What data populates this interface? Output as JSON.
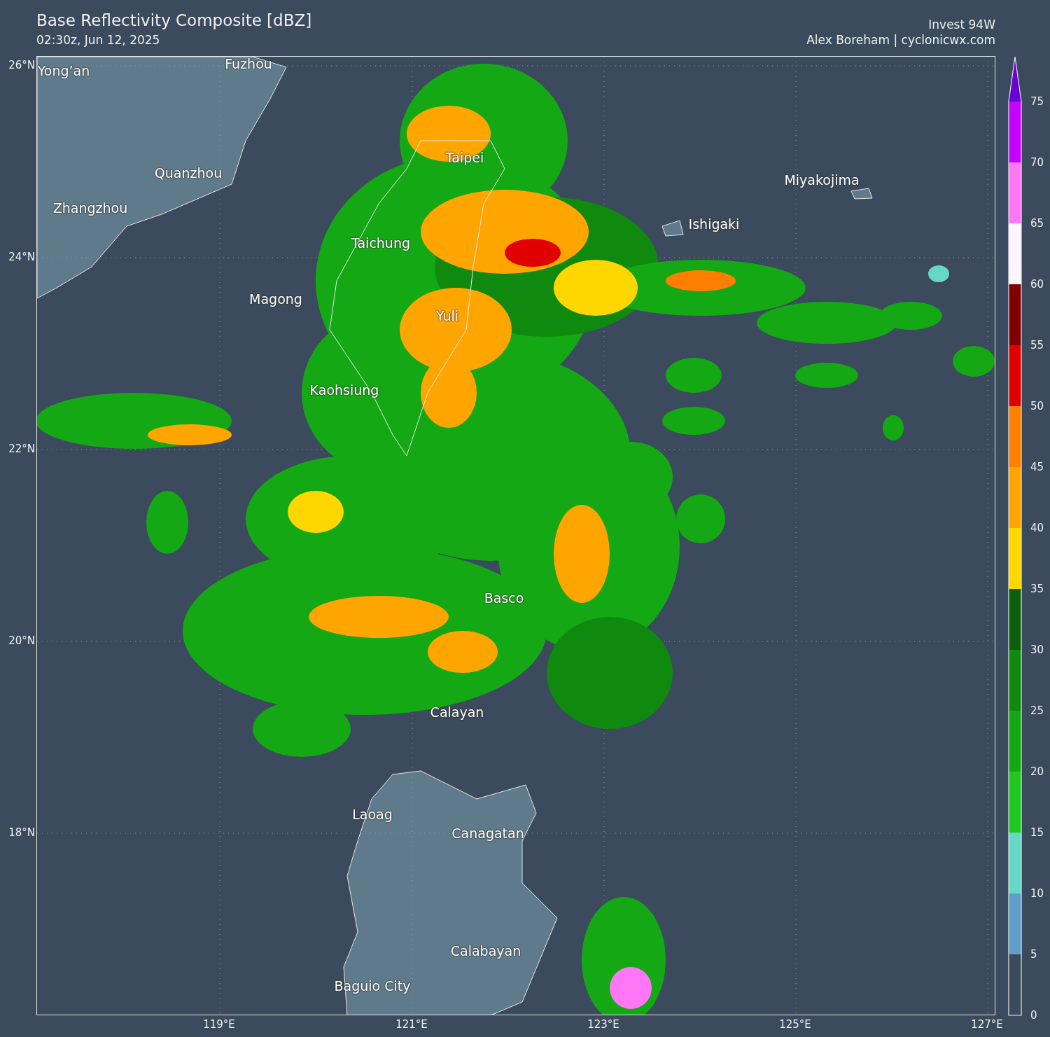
{
  "title": "Base Reflectivity Composite [dBZ]",
  "subtitle": "02:30z, Jun 12, 2025",
  "storm": "Invest 94W",
  "credit": "Alex Boreham | cyclonicwx.com",
  "map": {
    "lat_labels": [
      "26°N",
      "24°N",
      "22°N",
      "20°N",
      "18°N"
    ],
    "lon_labels": [
      "119°E",
      "121°E",
      "123°E",
      "125°E",
      "127°E"
    ],
    "places": [
      "Fuzhou",
      "Yong’an",
      "Quanzhou",
      "Zhangzhou",
      "Taichung",
      "Magong",
      "Taipei",
      "Yuli",
      "Kaohsiung",
      "Miyakojima",
      "Ishigaki",
      "Basco",
      "Calayan",
      "Laoag",
      "Canagatan",
      "Calabayan",
      "Baguio City"
    ]
  },
  "colorbar": {
    "over": {
      "color": "#6a00d8"
    },
    "bins": [
      {
        "color": "#3b4a5c"
      },
      {
        "color": "#5f9ec8"
      },
      {
        "color": "#66d8c6"
      },
      {
        "color": "#1ec81e"
      },
      {
        "color": "#14a814"
      },
      {
        "color": "#0f8a0f"
      },
      {
        "color": "#0b5e0b"
      },
      {
        "color": "#ffd700"
      },
      {
        "color": "#ffa500"
      },
      {
        "color": "#ff7f00"
      },
      {
        "color": "#e00000"
      },
      {
        "color": "#800000"
      },
      {
        "color": "#fff5ff"
      },
      {
        "color": "#ff77f5"
      },
      {
        "color": "#c800ff"
      }
    ],
    "labels": [
      "75",
      "70",
      "65",
      "60",
      "55",
      "50",
      "45",
      "40",
      "35",
      "30",
      "25",
      "20",
      "15",
      "10",
      "5",
      "0"
    ]
  }
}
